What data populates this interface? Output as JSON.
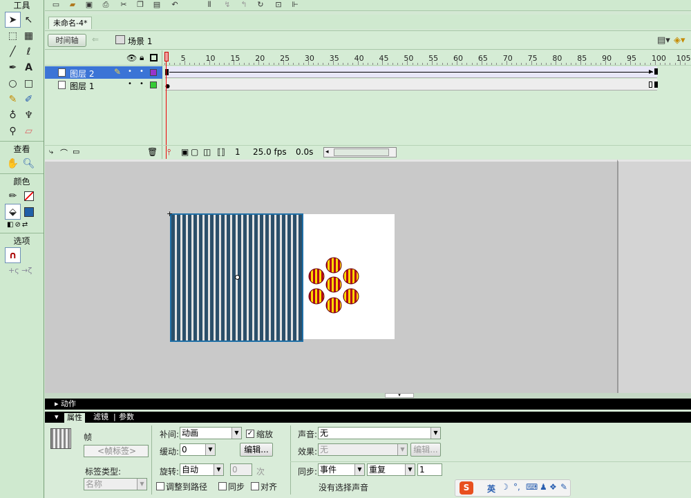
{
  "tools": {
    "title": "工具",
    "view_title": "查看",
    "color_title": "颜色",
    "options_title": "选项"
  },
  "document": {
    "tab_title": "未命名-4*"
  },
  "timeline_header": {
    "timeline_button": "时间轴",
    "scene_label": "场景 1"
  },
  "layers": [
    {
      "name": "图层 2",
      "selected": true,
      "color": "#9933cc"
    },
    {
      "name": "图层 1",
      "selected": false,
      "color": "#33cc33"
    }
  ],
  "ruler": [
    "1",
    "5",
    "10",
    "15",
    "20",
    "25",
    "30",
    "35",
    "40",
    "45",
    "50",
    "55",
    "60",
    "65",
    "70",
    "75",
    "80",
    "85",
    "90",
    "95",
    "100",
    "105"
  ],
  "status": {
    "current_frame": "1",
    "fps": "25.0 fps",
    "elapsed": "0.0s"
  },
  "panels": {
    "actions_label": "动作",
    "tabs": [
      "属性",
      "滤镜",
      "参数"
    ]
  },
  "properties": {
    "frame_label": "帧",
    "frame_label_placeholder": "<帧标签>",
    "label_type_label": "标签类型:",
    "label_type_value": "名称",
    "tween_label": "补间:",
    "tween_value": "动画",
    "scale_label": "缩放",
    "ease_label": "缓动:",
    "ease_value": "0",
    "edit_button": "编辑...",
    "rotate_label": "旋转:",
    "rotate_value": "自动",
    "rotate_count": "0",
    "rotate_unit": "次",
    "orient_to_path": "调整到路径",
    "sync_check": "同步",
    "snap_check": "对齐",
    "sound_label": "声音:",
    "sound_value": "无",
    "effect_label": "效果:",
    "effect_value": "无",
    "effect_edit_button": "编辑...",
    "sync_label": "同步:",
    "sync_value": "事件",
    "repeat_value": "重复",
    "repeat_count": "1",
    "no_sound": "没有选择声音"
  },
  "ime": {
    "lang": "英"
  },
  "colors": {
    "panel_bg": "#d4e8d4",
    "selection": "#3b74d6",
    "stripe_dark": "#2b4f6a",
    "ball_yellow": "#ffd800",
    "ball_red": "#b3001b"
  }
}
